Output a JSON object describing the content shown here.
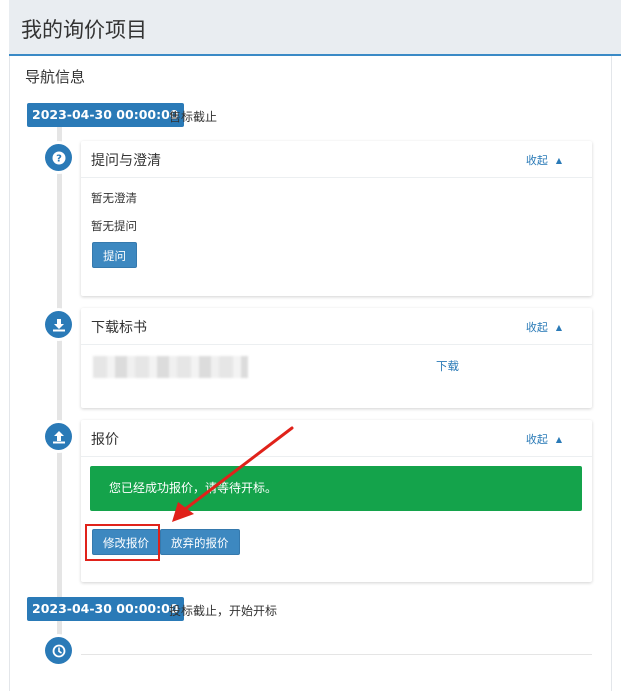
{
  "page": {
    "title": "我的询价项目"
  },
  "nav": {
    "title": "导航信息"
  },
  "timeline": {
    "start": {
      "date": "2023-04-30 00:00:00",
      "text": "售标截止"
    },
    "end": {
      "date": "2023-04-30 00:00:00",
      "text": "投标截止，开始开标"
    }
  },
  "sections": {
    "qa": {
      "title": "提问与澄清",
      "collapse_label": "收起",
      "no_clarification": "暂无澄清",
      "no_question": "暂无提问",
      "ask_button": "提问",
      "icon": "question-circle-icon"
    },
    "download": {
      "title": "下载标书",
      "collapse_label": "收起",
      "download_link": "下载",
      "icon": "download-icon"
    },
    "quote": {
      "title": "报价",
      "collapse_label": "收起",
      "success_message": "您已经成功报价，请等待开标。",
      "modify_button": "修改报价",
      "abandon_button": "放弃的报价",
      "icon": "upload-icon"
    },
    "final": {
      "icon": "clock-icon"
    }
  },
  "colors": {
    "primary": "#2a7ab7",
    "success": "#14a34b",
    "annotation": "#e0221a",
    "header_bg": "#e9edf1"
  }
}
